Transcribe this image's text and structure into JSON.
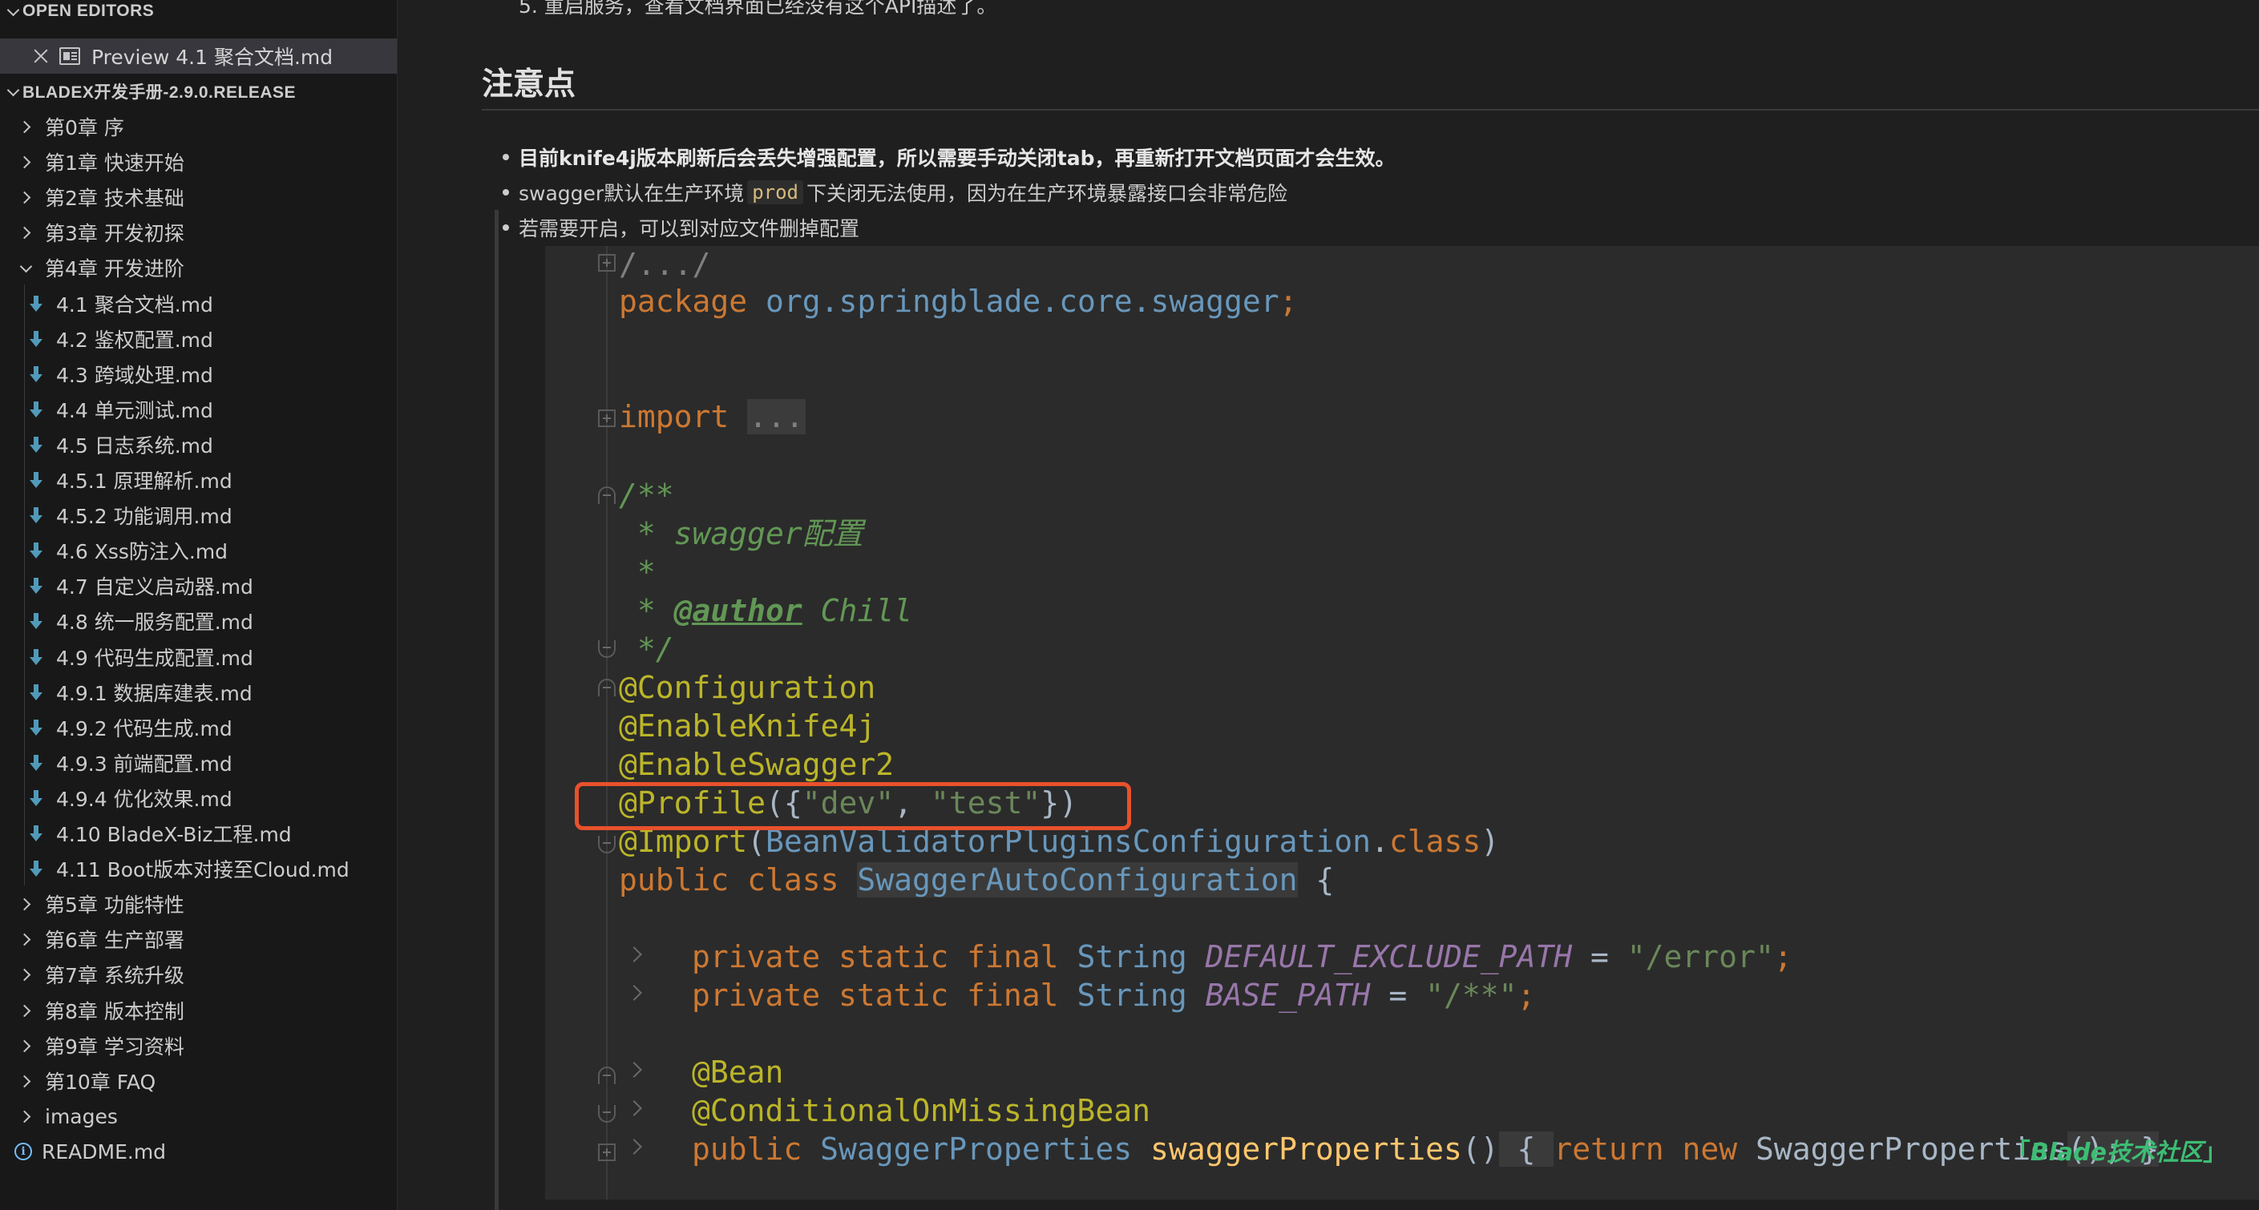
{
  "sidebar": {
    "open_editors_label": "OPEN EDITORS",
    "open_editor_file": "Preview 4.1 聚合文档.md",
    "project_label": "BLADEX开发手册-2.9.0.RELEASE",
    "chapters_top": [
      "第0章 序",
      "第1章 快速开始",
      "第2章 技术基础",
      "第3章 开发初探",
      "第4章 开发进阶"
    ],
    "chapter4_files": [
      "4.1 聚合文档.md",
      "4.2 鉴权配置.md",
      "4.3 跨域处理.md",
      "4.4 单元测试.md",
      "4.5 日志系统.md",
      "4.5.1 原理解析.md",
      "4.5.2 功能调用.md",
      "4.6 Xss防注入.md",
      "4.7 自定义启动器.md",
      "4.8 统一服务配置.md",
      "4.9 代码生成配置.md",
      "4.9.1 数据库建表.md",
      "4.9.2 代码生成.md",
      "4.9.3 前端配置.md",
      "4.9.4 优化效果.md",
      "4.10 BladeX-Biz工程.md",
      "4.11 Boot版本对接至Cloud.md"
    ],
    "chapters_bottom": [
      "第5章 功能特性",
      "第6章 生产部署",
      "第7章 系统升级",
      "第8章 版本控制",
      "第9章 学习资料",
      "第10章 FAQ",
      "images"
    ],
    "readme": "README.md"
  },
  "preview": {
    "top_cut_text": "5. 重启服务，查看文档界面已经没有这个API描述了。",
    "heading": "注意点",
    "bullets": {
      "b1": "目前knife4j版本刷新后会丢失增强配置，所以需要手动关闭tab，再重新打开文档页面才会生效。",
      "b2_pre": "swagger默认在生产环境",
      "b2_code": "prod",
      "b2_post": "下关闭无法使用，因为在生产环境暴露接口会非常危险",
      "b3": "若需要开启，可以到对应文件删掉配置"
    }
  },
  "code": {
    "l1": "/.../",
    "l2_kw": "package",
    "l2_pkg": "org.springblade.core.swagger",
    "l2_semi": ";",
    "l3_kw": "import",
    "l3_dots": "...",
    "l4": "/**",
    "l5_star": " * ",
    "l5_text": "swagger配置",
    "l6": " *",
    "l7_star": " * ",
    "l7_tag": "@author",
    "l7_name": " Chill",
    "l8": " */",
    "l9": "@Configuration",
    "l10": "@EnableKnife4j",
    "l11": "@EnableSwagger2",
    "l12_ann": "@Profile",
    "l12_open": "({",
    "l12_s1": "\"dev\"",
    "l12_comma": ", ",
    "l12_s2": "\"test\"",
    "l12_close": "})",
    "l13_ann": "@Import",
    "l13_open": "(",
    "l13_cls": "BeanValidatorPluginsConfiguration",
    "l13_dot": ".",
    "l13_kw": "class",
    "l13_close": ")",
    "l14_kw": "public class ",
    "l14_name": "SwaggerAutoConfiguration",
    "l14_brace": " {",
    "l15_kw": "private static final ",
    "l15_type": "String ",
    "l15_const": "DEFAULT_EXCLUDE_PATH",
    "l15_eq": " = ",
    "l15_str": "\"/error\"",
    "l15_semi": ";",
    "l16_kw": "private static final ",
    "l16_type": "String ",
    "l16_const": "BASE_PATH",
    "l16_eq": " = ",
    "l16_str": "\"/**\"",
    "l16_semi": ";",
    "l17": "@Bean",
    "l18": "@ConditionalOnMissingBean",
    "l19_kw": "public ",
    "l19_type": "SwaggerProperties ",
    "l19_fn": "swaggerProperties",
    "l19_paren": "()",
    "l19_open": " { ",
    "l19_ret": "return new ",
    "l19_new": "SwaggerProperties",
    "l19_end": "(); }"
  },
  "watermark": "Blade技术社区",
  "colors": {
    "sidebar_bg": "#181818",
    "main_bg": "#1f1f1f",
    "code_bg": "#2b2b2b",
    "highlight_box": "#e8512c",
    "keyword": "#cc7832",
    "annotation": "#bbb529",
    "string": "#6a8759",
    "watermark": "#3dbd74"
  }
}
